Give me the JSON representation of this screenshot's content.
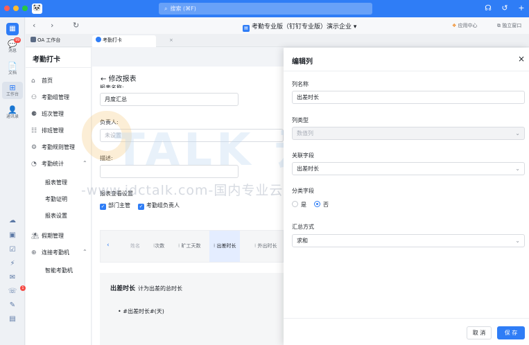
{
  "top": {
    "search_placeholder": "搜索 (⌘F)",
    "avatar_glyph": "🐼"
  },
  "leftnav": {
    "items": [
      {
        "label": "消息",
        "icon": "chat-icon",
        "glyph": "💬",
        "badge": "99"
      },
      {
        "label": "文档",
        "icon": "doc-icon",
        "glyph": "📄"
      },
      {
        "label": "工作台",
        "icon": "workbench-icon",
        "glyph": "⊞"
      },
      {
        "label": "通讯录",
        "icon": "contacts-icon",
        "glyph": "👤"
      }
    ],
    "bottom_badge": "1"
  },
  "toolbar": {
    "app_title": "考勤专业版（钉钉专业版）演示企业 ▾",
    "app_center": "应用中心",
    "standalone_window": "独立窗口"
  },
  "tabs": [
    {
      "label": "OA 工作台"
    },
    {
      "label": "考勤打卡",
      "close": "×"
    }
  ],
  "sidebar": {
    "title": "考勤打卡",
    "menu": [
      {
        "label": "首页",
        "icon": "home-icon",
        "glyph": "⌂"
      },
      {
        "label": "考勤组管理",
        "icon": "group-icon",
        "glyph": "⚇"
      },
      {
        "label": "班次管理",
        "icon": "shift-icon",
        "glyph": "⚈"
      },
      {
        "label": "排班管理",
        "icon": "schedule-icon",
        "glyph": "☷"
      },
      {
        "label": "考勤规则管理",
        "icon": "rules-icon",
        "glyph": "⚙"
      },
      {
        "label": "考勤统计",
        "icon": "stats-icon",
        "glyph": "◔",
        "caret": "⌃"
      },
      {
        "label": "假期管理",
        "icon": "holiday-icon",
        "glyph": "⛱"
      },
      {
        "label": "连接考勤机",
        "icon": "machine-icon",
        "glyph": "⊕",
        "caret": "⌃"
      }
    ],
    "stats_sub": [
      "报表管理",
      "考勤证明",
      "报表设置"
    ],
    "machine_sub": [
      "智能考勤机"
    ]
  },
  "main": {
    "back_title": "修改报表",
    "report_name_label": "报表名称:",
    "report_name_value": "月度汇总",
    "owner_label": "负责人:",
    "owner_placeholder": "未设置",
    "desc_label": "描述:",
    "visibility_label": "报表查看设置",
    "checkbox_dept": "部门主管",
    "checkbox_group": "考勤组负责人",
    "columns": [
      "姓名",
      "⁝次数",
      "⁝ 旷工天数",
      "⁝ 出差时长",
      "⁝ 外出时长"
    ],
    "desc_title": "出差时长",
    "desc_subtitle": "计为出差的总时长",
    "desc_item": "#出差时长#(天)"
  },
  "panel": {
    "title": "编辑列",
    "close": "×",
    "col_name_label": "列名称",
    "col_name_value": "出差时长",
    "col_type_label": "列类型",
    "col_type_value": "数值列",
    "field_label": "关联字段",
    "field_value": "出差时长",
    "category_label": "分类字段",
    "radio_yes": "是",
    "radio_no": "否",
    "radio_selected": "否",
    "summary_label": "汇总方式",
    "summary_value": "求和",
    "cancel": "取 消",
    "save": "保 存"
  },
  "watermark": {
    "url": "-www.idctalk.com-国内专业云计算交流服务平台-",
    "brand": "TALK 云说"
  },
  "colors": {
    "accent": "#2f7df6",
    "topbar": "#2f7df6"
  }
}
